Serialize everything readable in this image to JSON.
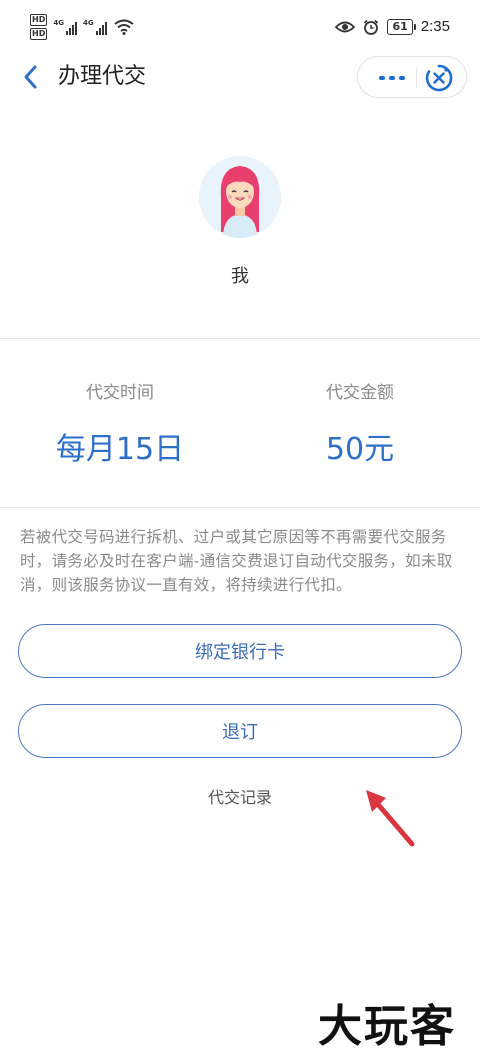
{
  "status_bar": {
    "hd_badges": [
      "HD",
      "HD"
    ],
    "network_labels": [
      "4G",
      "4G"
    ],
    "battery": "61",
    "time": "2:35",
    "icons": [
      "eye-icon",
      "alarm-icon",
      "wifi-icon",
      "signal-icon"
    ]
  },
  "header": {
    "title": "办理代交",
    "icons": [
      "back-arrow-icon",
      "more-icon",
      "close-circle-icon"
    ]
  },
  "profile": {
    "name": "我"
  },
  "info": {
    "time_label": "代交时间",
    "time_value": "每月15日",
    "amount_label": "代交金额",
    "amount_value": "50元"
  },
  "notice": "若被代交号码进行拆机、过户或其它原因等不再需要代交服务时，请务必及时在客户端-通信交费退订自动代交服务，如未取消，则该服务协议一直有效，将持续进行代扣。",
  "buttons": {
    "bind_card": "绑定银行卡",
    "unsubscribe": "退订"
  },
  "record_link": "代交记录",
  "watermark": "大玩客",
  "colors": {
    "accent": "#2e6fc9",
    "button_border": "#4b7bc6",
    "annotation_arrow": "#d9363e"
  }
}
